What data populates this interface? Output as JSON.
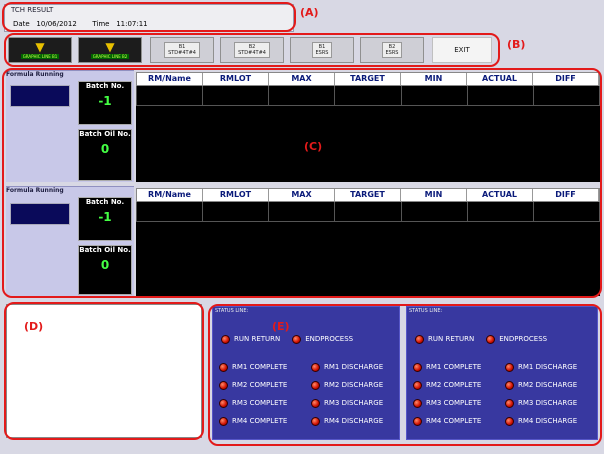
{
  "header": {
    "title": "TCH RESULT",
    "date_label": "Date",
    "date": "10/06/2012",
    "time_label": "Time",
    "time": "11:07:11"
  },
  "buttons": {
    "gl1": "GRAPHIC LINE B1",
    "gl2": "GRAPHIC LINE B2",
    "b1a": "B1",
    "b1a_sub": "STD#4T#4",
    "b2a": "B2",
    "b2a_sub": "STD#4T#4",
    "b1b": "B1",
    "b1b_sub": "ESRS",
    "b2b": "B2",
    "b2b_sub": "ESRS",
    "exit": "EXIT"
  },
  "formula": {
    "label": "Formula Running",
    "batch_label": "Batch No.",
    "batch_val": "-1",
    "oil_label": "Batch Oil No.",
    "oil_val": "0"
  },
  "columns": [
    "RM/Name",
    "RMLOT",
    "MAX",
    "TARGET",
    "MIN",
    "ACTUAL",
    "DIFF"
  ],
  "status": {
    "label": "STATUS LINE:",
    "run_return": "RUN RETURN",
    "endprocess": "ENDPROCESS",
    "complete": [
      "RM1 COMPLETE",
      "RM2 COMPLETE",
      "RM3 COMPLETE",
      "RM4 COMPLETE"
    ],
    "discharge": [
      "RM1 DISCHARGE",
      "RM2 DISCHARGE",
      "RM3 DISCHARGE",
      "RM4 DISCHARGE"
    ]
  },
  "annotations": {
    "a": "(A)",
    "b": "(B)",
    "c": "(C)",
    "d": "(D)",
    "e": "(E)"
  },
  "colors": {
    "annotation": "#e31a1a",
    "grid_bg": "#000000",
    "header_text": "#0a1a7a",
    "led": "#d01000"
  }
}
